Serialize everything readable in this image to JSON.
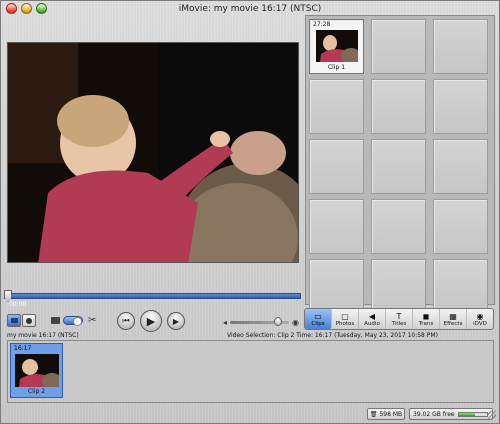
{
  "window": {
    "title": "iMovie: my movie  16:17 (NTSC)"
  },
  "viewer": {
    "timecode": ":00:00",
    "playhead_fraction": 0.0
  },
  "controls": {
    "icons": [
      "camera-mode-icon",
      "edit-mode-icon",
      "scissors-icon",
      "rewind-icon",
      "play-icon",
      "fullscreen-play-icon",
      "volume-low-icon",
      "volume-high-icon"
    ],
    "rewind_glyph": "⏮",
    "play_glyph": "▶",
    "fullscreen_glyph": "▶",
    "volume_fraction": 0.82,
    "scissors_glyph": "✂"
  },
  "clips_panel": {
    "clips": [
      {
        "duration": "27:28",
        "label": "Clip 1"
      }
    ],
    "empty_slots": 14
  },
  "pane_switcher": {
    "buttons": [
      {
        "label": "Clips",
        "icon": "clips-icon",
        "glyph": "▭"
      },
      {
        "label": "Photos",
        "icon": "photos-icon",
        "glyph": "▢"
      },
      {
        "label": "Audio",
        "icon": "audio-icon",
        "glyph": "◀"
      },
      {
        "label": "Titles",
        "icon": "titles-icon",
        "glyph": "T"
      },
      {
        "label": "Trans",
        "icon": "transitions-icon",
        "glyph": "◼"
      },
      {
        "label": "Effects",
        "icon": "effects-icon",
        "glyph": "▦"
      },
      {
        "label": "iDVD",
        "icon": "idvd-icon",
        "glyph": "◉"
      }
    ],
    "active": "Clips"
  },
  "status": {
    "movie_info": "my movie  16:17 (NTSC)",
    "selection_info": "Video Selection: Clip 2  Time: 16:17 (Tuesday, May 23, 2017 10:58 PM)"
  },
  "timeline": {
    "clips": [
      {
        "duration": "16:17",
        "label": "Clip 2"
      }
    ]
  },
  "bottom": {
    "trash_label": "598 MB",
    "free_label": "39.02 GB free",
    "free_fraction": 0.6
  },
  "colors": {
    "accent": "#3b6fc8",
    "selection": "#6f9fe8"
  }
}
